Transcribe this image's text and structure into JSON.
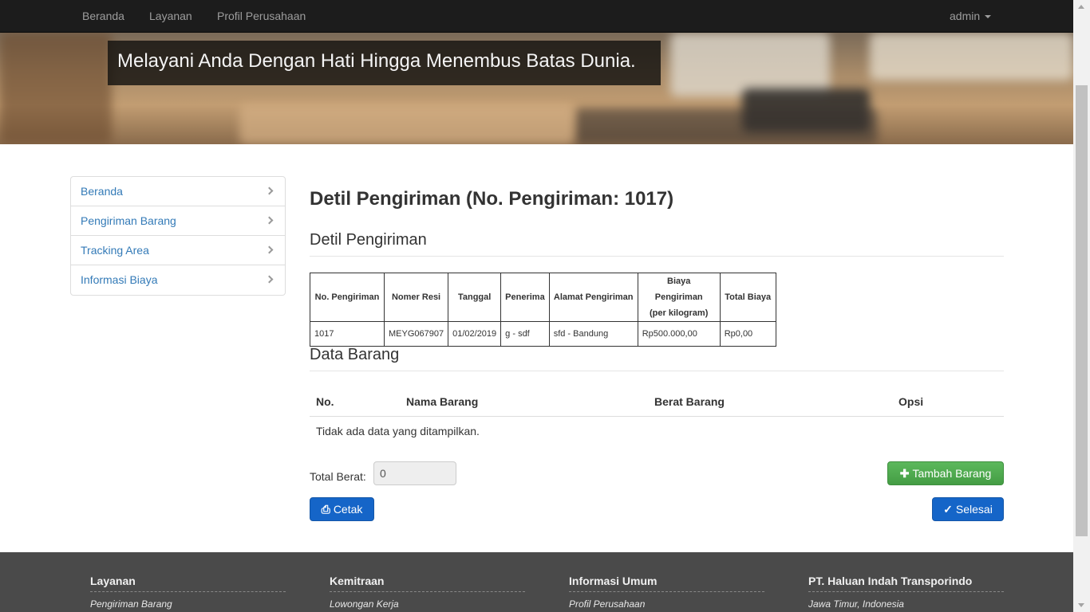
{
  "navbar": {
    "links": [
      "Beranda",
      "Layanan",
      "Profil Perusahaan"
    ],
    "user": "admin"
  },
  "hero": {
    "tagline": "Melayani Anda Dengan Hati Hingga Menembus Batas Dunia."
  },
  "sidebar": {
    "items": [
      {
        "label": "Beranda"
      },
      {
        "label": "Pengiriman Barang"
      },
      {
        "label": "Tracking Area"
      },
      {
        "label": "Informasi Biaya"
      }
    ]
  },
  "main": {
    "page_title": "Detil Pengiriman (No. Pengiriman: 1017)",
    "detail_section_title": "Detil Pengiriman",
    "detail_table": {
      "headers": [
        "No. Pengiriman",
        "Nomer Resi",
        "Tanggal",
        "Penerima",
        "Alamat Pengiriman",
        "Biaya Pengiriman",
        "(per kilogram)",
        "Total Biaya"
      ],
      "row": [
        "1017",
        "MEYG067907",
        "01/02/2019",
        "g - sdf",
        "sfd - Bandung",
        "Rp500.000,00",
        "Rp0,00"
      ]
    },
    "goods_section_title": "Data Barang",
    "goods_table": {
      "headers": [
        "No.",
        "Nama Barang",
        "Berat Barang",
        "Opsi"
      ],
      "empty_text": "Tidak ada data yang ditampilkan."
    },
    "total_label": "Total Berat:",
    "total_value": "0",
    "buttons": {
      "add": "Tambah Barang",
      "print": "Cetak",
      "finish": "Selesai"
    }
  },
  "footer": {
    "columns": [
      {
        "title": "Layanan",
        "item": "Pengiriman Barang"
      },
      {
        "title": "Kemitraan",
        "item": "Lowongan Kerja"
      },
      {
        "title": "Informasi Umum",
        "item": "Profil Perusahaan"
      },
      {
        "title": "PT. Haluan Indah Transporindo",
        "item": "Jawa Timur, Indonesia"
      }
    ]
  },
  "colors": {
    "link": "#337ab7",
    "navbar": "#1c1c1c",
    "button_green": "#5cb85c",
    "button_blue": "#1565c8",
    "footer": "#4a4a4a"
  }
}
